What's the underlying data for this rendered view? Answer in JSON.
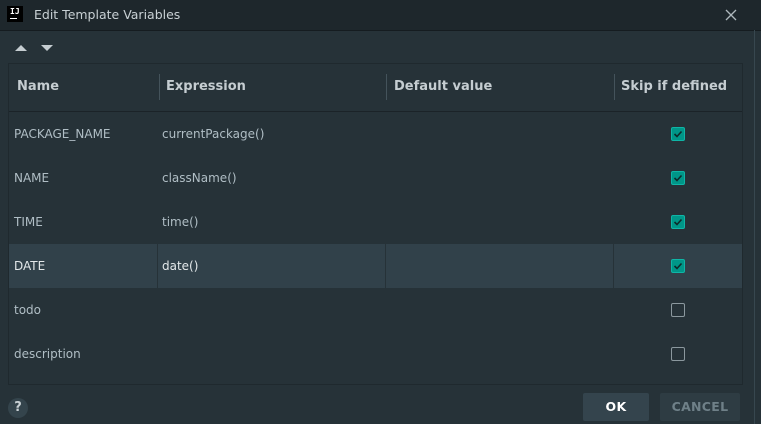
{
  "window": {
    "title": "Edit Template Variables",
    "logo_text": "IJ"
  },
  "toolbar": {
    "move_up": "triangle-up-icon",
    "move_down": "triangle-down-icon"
  },
  "table": {
    "columns": [
      "Name",
      "Expression",
      "Default value",
      "Skip if defined"
    ],
    "rows": [
      {
        "name": "PACKAGE_NAME",
        "expression": "currentPackage()",
        "default": "",
        "skip": true,
        "selected": false
      },
      {
        "name": "NAME",
        "expression": "className()",
        "default": "",
        "skip": true,
        "selected": false
      },
      {
        "name": "TIME",
        "expression": "time()",
        "default": "",
        "skip": true,
        "selected": false
      },
      {
        "name": "DATE",
        "expression": "date()",
        "default": "",
        "skip": true,
        "selected": true
      },
      {
        "name": "todo",
        "expression": "",
        "default": "",
        "skip": false,
        "selected": false
      },
      {
        "name": "description",
        "expression": "",
        "default": "",
        "skip": false,
        "selected": false
      }
    ]
  },
  "footer": {
    "help_label": "?",
    "ok_label": "OK",
    "cancel_label": "CANCEL"
  },
  "colors": {
    "background": "#263238",
    "accent": "#009688",
    "selection": "#31414a"
  }
}
